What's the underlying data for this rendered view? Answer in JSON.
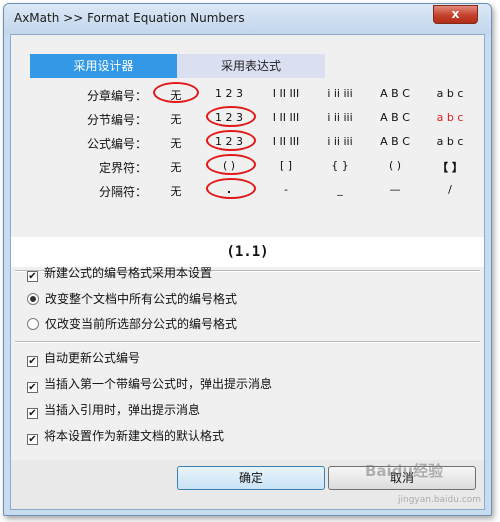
{
  "window": {
    "title": "AxMath >> Format Equation Numbers",
    "close_glyph": "x"
  },
  "tabs": [
    {
      "label": "采用设计器",
      "active": true
    },
    {
      "label": "采用表达式",
      "active": false
    }
  ],
  "format_rows": [
    {
      "label": "分章编号：",
      "options": [
        "无",
        "1 2 3",
        "I II III",
        "i ii iii",
        "A B C",
        "a b c"
      ],
      "selected": 0
    },
    {
      "label": "分节编号：",
      "options": [
        "无",
        "1 2 3",
        "I II III",
        "i ii iii",
        "A B C",
        "a b c"
      ],
      "selected": 1
    },
    {
      "label": "公式编号：",
      "options": [
        "无",
        "1 2 3",
        "I II III",
        "i ii iii",
        "A B C",
        "a b c"
      ],
      "selected": 1
    },
    {
      "label": "定界符：",
      "options": [
        "无",
        "( )",
        "[ ]",
        "{ }",
        "( )",
        "【 】"
      ],
      "selected": 1
    },
    {
      "label": "分隔符：",
      "options": [
        "无",
        ".",
        "-",
        "_",
        "—",
        "/"
      ],
      "selected": 1
    }
  ],
  "preview": "(1.1)",
  "apply_options": [
    {
      "type": "checkbox",
      "label": "新建公式的编号格式采用本设置",
      "checked": true
    },
    {
      "type": "radio",
      "label": "改变整个文档中所有公式的编号格式",
      "checked": true
    },
    {
      "type": "radio",
      "label": "仅改变当前所选部分公式的编号格式",
      "checked": false
    }
  ],
  "extra_options": [
    {
      "label": "自动更新公式编号",
      "checked": true
    },
    {
      "label": "当插入第一个带编号公式时，弹出提示消息",
      "checked": true
    },
    {
      "label": "当插入引用时，弹出提示消息",
      "checked": true
    },
    {
      "label": "将本设置作为新建文档的默认格式",
      "checked": true
    }
  ],
  "buttons": {
    "ok": "确定",
    "cancel": "取消"
  },
  "watermark": {
    "text": "Baidu经验",
    "url": "jingyan.baidu.com"
  },
  "colors": {
    "accent_tab": "#3399e6",
    "highlight_red": "#e21818",
    "title_bar": "#c8dcf0"
  }
}
